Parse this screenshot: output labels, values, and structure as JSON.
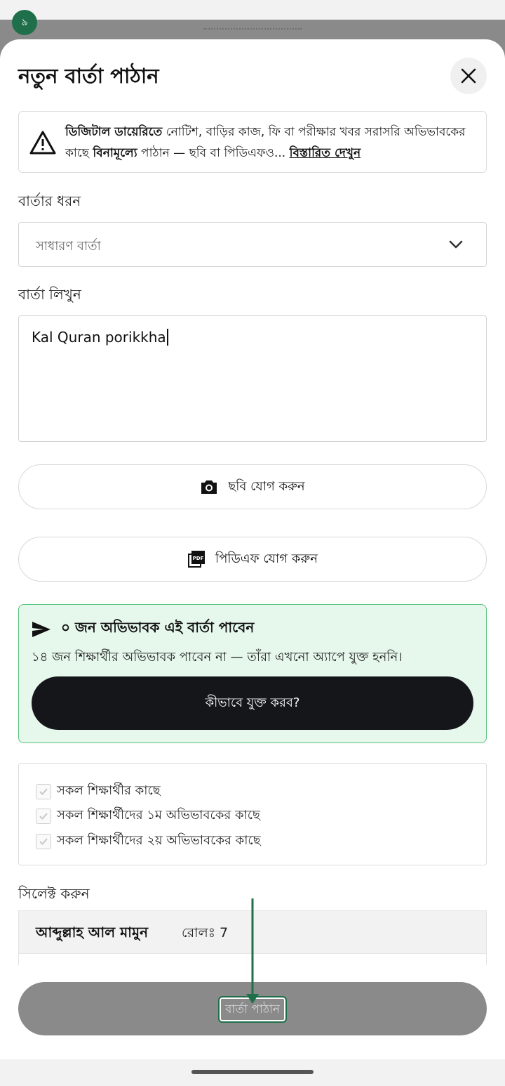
{
  "status": {
    "step_badge": "৯"
  },
  "sheet": {
    "title": "নতুন বার্তা পাঠান",
    "notice": {
      "bold_lead": "ডিজিটাল ডায়েরিতে",
      "text_1": " নোটিশ, বাড়ির কাজ, ফি বা পরীক্ষার খবর সরাসরি অভিভাবকের কাছে ",
      "bold_mid": "বিনামূল্যে",
      "text_2": " পাঠান — ছবি বা পিডিএফও... ",
      "link": "বিস্তারিত দেখুন"
    },
    "type_label": "বার্তার ধরন",
    "type_value": "সাধারণ বার্তা",
    "message_label": "বার্তা লিখুন",
    "message_value": "Kal Quran porikkha",
    "add_photo": "ছবি যোগ করুন",
    "add_pdf": "পিডিএফ যোগ করুন",
    "pdf_icon_text": "PDF",
    "info": {
      "title": "০ জন অভিভাবক এই বার্তা পাবেন",
      "subtitle": "১৪ জন শিক্ষার্থীর অভিভাবক পাবেন না — তাঁরা এখনো অ্যাপে যুক্ত হননি।",
      "button": "কীভাবে যুক্ত করব?"
    },
    "recipients": [
      {
        "label": "সকল শিক্ষার্থীর কাছে",
        "checked": true
      },
      {
        "label": "সকল শিক্ষার্থীদের ১ম অভিভাবকের কাছে",
        "checked": true
      },
      {
        "label": "সকল শিক্ষার্থীদের ২য় অভিভাবকের কাছে",
        "checked": true
      }
    ],
    "select_label": "সিলেক্ট করুন",
    "student": {
      "name": "আব্দুল্লাহ আল মামুন",
      "roll": "রোলঃ 7"
    },
    "send_button": "বার্তা পাঠান"
  },
  "colors": {
    "accent_green": "#1f6f4a",
    "info_bg": "#e6f7ec",
    "info_border": "#58c27d",
    "dark_button": "#141619",
    "disabled_button": "#8a8a8a"
  }
}
